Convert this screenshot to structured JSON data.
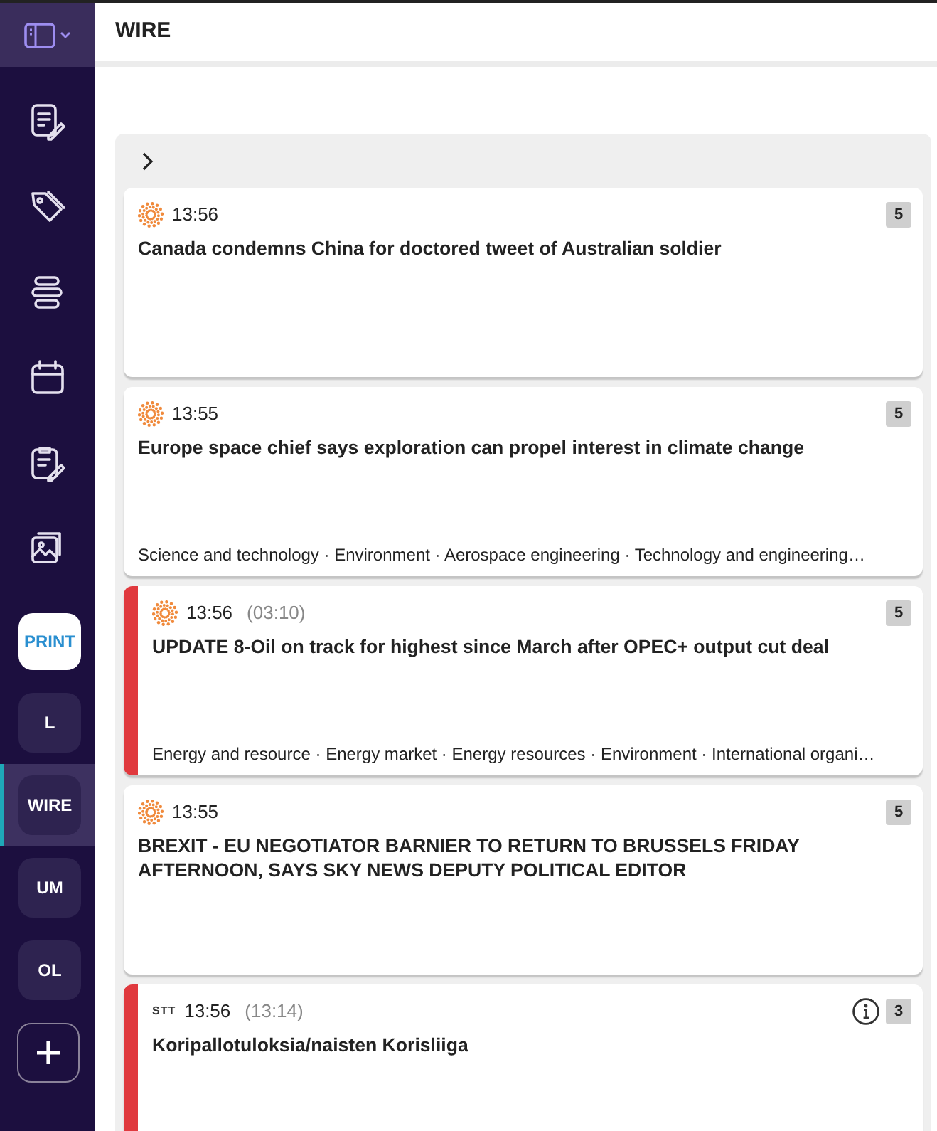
{
  "header": {
    "title": "WIRE"
  },
  "sidebar": {
    "icons": [
      {
        "kind": "edit"
      },
      {
        "kind": "tags"
      },
      {
        "kind": "list"
      },
      {
        "kind": "calendar"
      },
      {
        "kind": "clipboard"
      },
      {
        "kind": "images"
      }
    ],
    "desks": [
      {
        "label": "PRINT",
        "kind": "print",
        "selected": false
      },
      {
        "label": "L",
        "kind": "desk",
        "selected": false
      },
      {
        "label": "WIRE",
        "kind": "desk",
        "selected": true
      },
      {
        "label": "UM",
        "kind": "desk",
        "selected": false
      },
      {
        "label": "OL",
        "kind": "desk",
        "selected": false
      }
    ]
  },
  "items": [
    {
      "kind": "reuters",
      "time": "13:56",
      "headline": "Canada condemns China for doctored tweet of Australian soldier",
      "priority": "5",
      "urgent": false,
      "info": false
    },
    {
      "kind": "reuters",
      "time": "13:55",
      "headline": "Europe space chief says exploration can propel interest in climate change",
      "subjects": "Science and technology · Environment · Aerospace engineering · Technology and engineering…",
      "priority": "5",
      "urgent": false,
      "info": false
    },
    {
      "kind": "reuters",
      "time": "13:56",
      "original_time": "(03:10)",
      "headline": "UPDATE 8-Oil on track for highest since March after OPEC+ output cut deal",
      "subjects": "Energy and resource · Energy market · Energy resources · Environment · International organi…",
      "priority": "5",
      "urgent": true,
      "info": false
    },
    {
      "kind": "reuters",
      "time": "13:55",
      "headline": "BREXIT - EU NEGOTIATOR BARNIER TO RETURN TO BRUSSELS FRIDAY AFTERNOON, SAYS SKY NEWS DEPUTY POLITICAL EDITOR",
      "priority": "5",
      "urgent": false,
      "info": false
    },
    {
      "kind": "stt",
      "source_label": "STT",
      "time": "13:56",
      "original_time": "(13:14)",
      "headline": "Koripallotuloksia/naisten Korisliiga",
      "priority": "3",
      "urgent": true,
      "info": true
    }
  ]
}
